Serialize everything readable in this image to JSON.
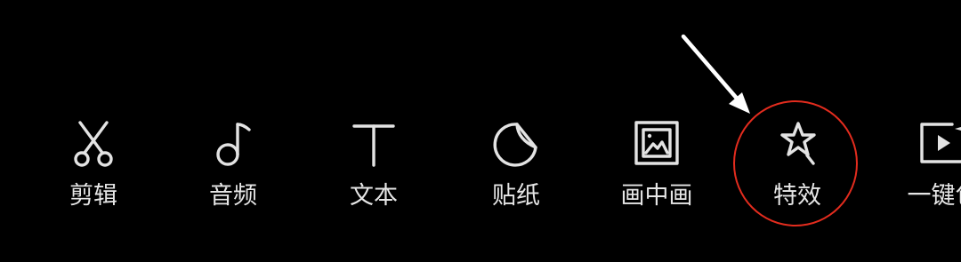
{
  "toolbar": {
    "items": [
      {
        "label": "剪辑",
        "icon": "scissors-icon"
      },
      {
        "label": "音频",
        "icon": "music-note-icon"
      },
      {
        "label": "文本",
        "icon": "text-t-icon"
      },
      {
        "label": "贴纸",
        "icon": "sticker-icon"
      },
      {
        "label": "画中画",
        "icon": "picture-in-picture-icon"
      },
      {
        "label": "特效",
        "icon": "star-sparkle-icon"
      },
      {
        "label": "一键包",
        "icon": "video-sparkle-icon"
      }
    ],
    "highlighted_item": "特效",
    "highlight_color": "#e32c1e",
    "icon_color": "#e3e3e3",
    "background_color": "#000000"
  }
}
